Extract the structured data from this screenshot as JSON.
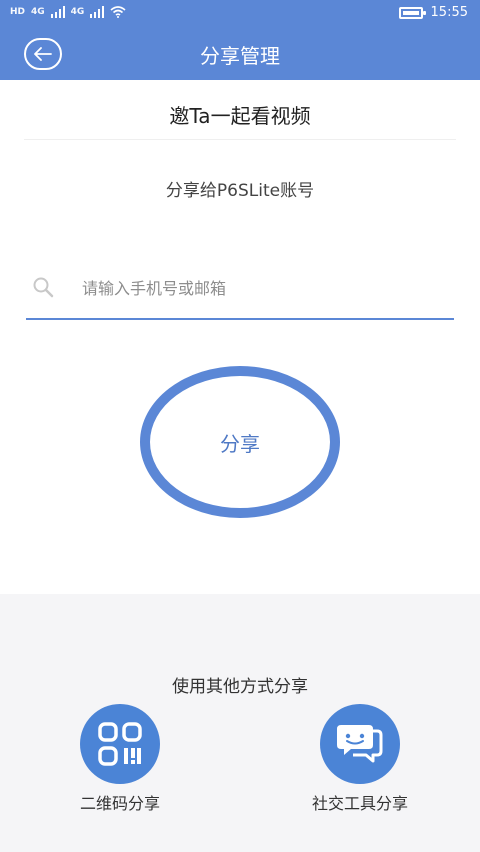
{
  "status_bar": {
    "left_chips": [
      "HD",
      "4G",
      "4G"
    ],
    "time": "15:55"
  },
  "app_bar": {
    "title": "分享管理",
    "back_icon": "arrow-left-icon"
  },
  "content": {
    "invite_title": "邀Ta一起看视频",
    "share_to": "分享给P6SLite账号",
    "search": {
      "placeholder": "请输入手机号或邮箱",
      "value": ""
    },
    "share_button_label": "分享"
  },
  "other_methods": {
    "title": "使用其他方式分享",
    "options": [
      {
        "label": "二维码分享",
        "icon": "qr-code-icon"
      },
      {
        "label": "社交工具分享",
        "icon": "chat-bubbles-icon"
      }
    ]
  },
  "colors": {
    "accent": "#5b87d6",
    "icon_bg": "#4b84d6",
    "panel_bg": "#f5f5f7"
  }
}
